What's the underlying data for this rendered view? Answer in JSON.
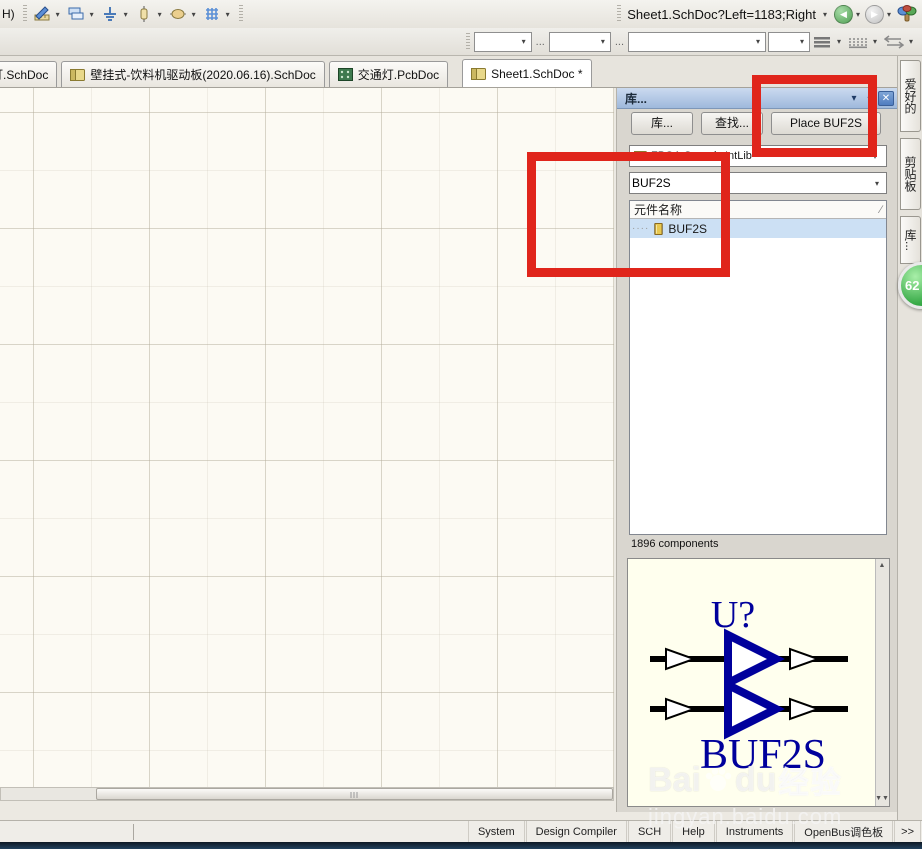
{
  "titlebar": {
    "menu_fragment": "H)"
  },
  "toolbar": {
    "icons": [
      {
        "name": "drawing-tools"
      },
      {
        "name": "sheet-symbol"
      },
      {
        "name": "power-port"
      },
      {
        "name": "part"
      },
      {
        "name": "net-label"
      },
      {
        "name": "grid"
      }
    ],
    "address_value": "Sheet1.SchDoc?Left=1183;Right",
    "dropdown_glyph": "▾"
  },
  "format_toolbar": {
    "ellipsis": "..."
  },
  "tabs": [
    {
      "label": "通灯.SchDoc",
      "type": "sch"
    },
    {
      "label": "壁挂式-饮料机驱动板(2020.06.16).SchDoc",
      "type": "sch"
    },
    {
      "label": "交通灯.PcbDoc",
      "type": "pcb"
    },
    {
      "label": "Sheet1.SchDoc *",
      "type": "sch"
    }
  ],
  "library_panel": {
    "title": "库...",
    "menu_glyph": "▾",
    "pin_glyph": "+",
    "close_glyph": "✕",
    "buttons": {
      "libraries": "库...",
      "search": "查找...",
      "place": "Place BUF2S"
    },
    "library_select": "FPGA Generic.IntLib",
    "filter_value": "BUF2S",
    "list": {
      "header": "元件名称",
      "sort_indicator": "∕",
      "items": [
        {
          "name": "BUF2S"
        }
      ]
    },
    "count": "1896 components",
    "preview": {
      "designator": "U?",
      "name": "BUF2S"
    }
  },
  "right_tabs": [
    {
      "label": "爱好的"
    },
    {
      "label": "剪贴板"
    },
    {
      "label": "库..."
    }
  ],
  "badge": {
    "value": "62"
  },
  "statusbar": {
    "panels": [
      "System",
      "Design Compiler",
      "SCH",
      "Help",
      "Instruments",
      "OpenBus调色板"
    ],
    "more": ">>"
  },
  "watermark": {
    "logo_left": "Bai",
    "logo_right": "du",
    "logo_cn": "经验",
    "url": "jingyan.baidu.com"
  },
  "colors": {
    "annotation_red": "#E0251B",
    "symbol_navy": "#00009C",
    "preview_bg": "#FFFFEE",
    "selection_blue": "#CCE0F4",
    "panel_header_blue": "#AFC6E4"
  }
}
